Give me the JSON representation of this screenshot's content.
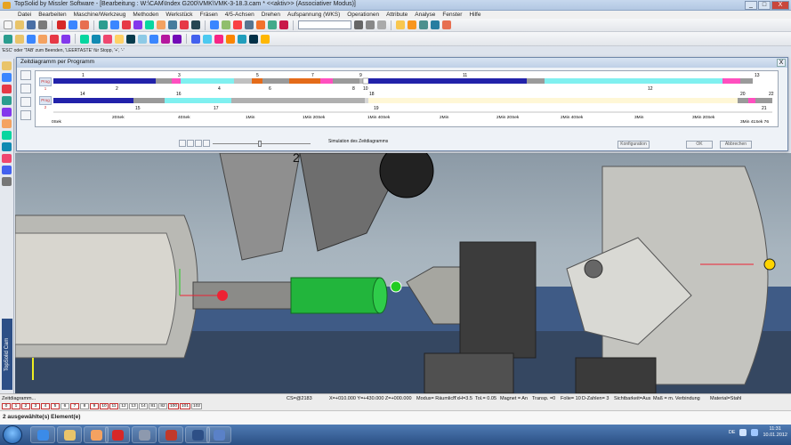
{
  "window": {
    "title": "TopSolid by Missler Software - [Bearbeitung : W:\\CAM\\Index G200\\VMK\\VMK-3-18.3.cam *  <<aktiv>> (Associativer Modus)]",
    "buttons": [
      "_",
      "□",
      "X"
    ]
  },
  "menu": [
    "Datei",
    "Bearbeiten",
    "Maschine/Werkzeug",
    "Methoden",
    "Werkstück",
    "Fräsen",
    "4/5-Achsen",
    "Drehen",
    "Aufspannung (WKS)",
    "Operationen",
    "Attribute",
    "Analyse",
    "Fenster",
    "Hilfe"
  ],
  "hint": "'ESC' oder 'TAB' zum Beenden, 'LEERTASTE' für Stopp, '+', '-'",
  "dialog": {
    "title": "Zeitdiagramm per Programm",
    "close": "X",
    "prog1": "Prog 1",
    "prog2": "Prog 2",
    "simulation_label": "Simulation des Zeitdiagramms",
    "buttons": [
      "Konfiguration",
      "OK",
      "Abbrechen"
    ],
    "ticks": [
      "0Sek",
      "20Sek",
      "40Sek",
      "1Min",
      "1Min 20Sek",
      "1Min 40Sek",
      "2Min",
      "2Min 20Sek",
      "2Min 40Sek",
      "3Min",
      "3Min 20Sek",
      "3Min 41Sek 76"
    ],
    "prog1_numbers": [
      "1",
      "2",
      "3",
      "4",
      "5",
      "6",
      "7",
      "8",
      "9",
      "10",
      "11",
      "12",
      "13"
    ],
    "prog2_numbers": [
      "14",
      "15",
      "16",
      "17",
      "18",
      "19",
      "20",
      "21",
      "22"
    ]
  },
  "status": {
    "left": "Zeitdiagramm...",
    "cs": "CS=@2183",
    "coords": "X=+010.000   Y=+430.000   Z=+000.000",
    "modus": "Modus= Räumlich",
    "txh": "TxH=3.5",
    "tol": "Tol.= 0.05",
    "magnet": "Magnet = An",
    "transp": "Transp. =0",
    "folie": "Folie= 10",
    "dzahlen": "D-Zahlen= 3",
    "sicht": "Sichtbarkeit=Aus",
    "mass": "Maß = m. Verbindung",
    "material": "Material=Stahl"
  },
  "pages": [
    "0",
    "1",
    "2",
    "3",
    "4",
    "5",
    "6",
    "7",
    "8",
    "9",
    "10",
    "11",
    "12",
    "13",
    "14",
    "81",
    "82",
    "100",
    "101",
    "102"
  ],
  "selection": "2 ausgewählte(s) Element(e)",
  "viewport_label": "2",
  "brand": "TopSolid Cam",
  "tray": {
    "lang": "DE",
    "time": "11:31",
    "date": "10.01.2012"
  }
}
